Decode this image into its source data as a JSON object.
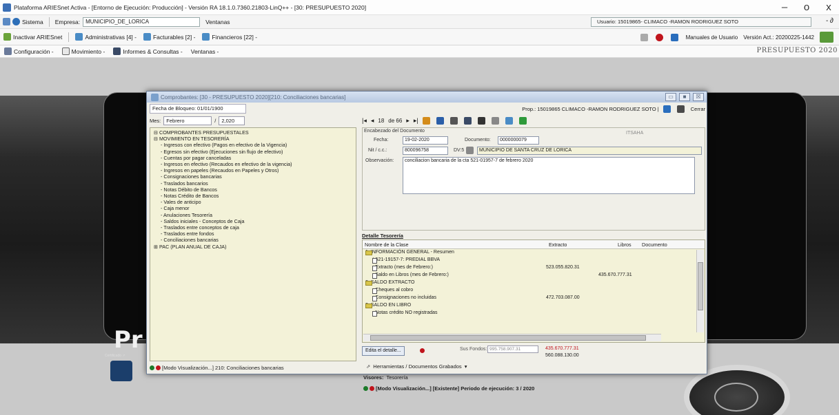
{
  "titlebar": {
    "title": "Plataforma ARIESnet Activa - [Entorno de Ejecución: Producción] - Versión RA 18.1.0.7360.21803-LinQ++ - [30: PRESUPUESTO 2020]",
    "minimize": "–",
    "maximize": "o",
    "close": "x"
  },
  "toolbar1": {
    "sistema": "Sistema",
    "empresa_label": "Empresa:",
    "empresa_value": "MUNICIPIO_DE_LORICA",
    "ventanas": "Ventanas",
    "usuario": "Usuario: 15019865- CLIMACO -RAMON RODRIGUEZ SOTO",
    "ctl": "- ∂"
  },
  "toolbar2": {
    "inactivar": "Inactivar ARIESnet",
    "administrativas": "Administrativas [4] -",
    "facturables": "Facturables [2] -",
    "financieros": "Financieros [22] -",
    "manuales": "Manuales de Usuario",
    "version": "Versión Act.: 20200225-1442"
  },
  "menubar": {
    "configuracion": "Configuración -",
    "movimiento": "Movimiento -",
    "informes": "Informes & Consultas -",
    "ventanas": "Ventanas -",
    "brand": "PRESUPUESTO 2020"
  },
  "desktop": {
    "big_text": "Pr",
    "tiny_text": "Certificado ↗"
  },
  "window": {
    "title": "Comprobantes: [30 - PRESUPUESTO 2020][210: Conciliaciones bancarias]",
    "btn_min": "▭",
    "btn_max": "■",
    "btn_close": "☒",
    "fecha_bloqueo": "Fecha de Bloqueo: 01/01/1900",
    "mes_label": "Mes:",
    "mes_value": "Febrero",
    "slash": "/",
    "anio_value": "2,020",
    "tree": [
      {
        "text": "⊟ COMPROBANTES PRESUPUESTALES",
        "level": 1
      },
      {
        "text": "⊟ MOVIMIENTO EN TESORERÍA",
        "level": 1
      },
      {
        "text": "Ingresos con efectivo (Pagos en efectivo de la Vigencia)",
        "level": 2
      },
      {
        "text": "Egresos sin efectivo (Ejecuciones sin flujo de efectivo)",
        "level": 2
      },
      {
        "text": "Cuentas por pagar canceladas",
        "level": 2
      },
      {
        "text": "Ingresos en efectivo (Recaudos en efectivo de la vigencia)",
        "level": 2
      },
      {
        "text": "Ingresos en papeles (Recaudos en Papeles y Otros)",
        "level": 2
      },
      {
        "text": "Consignaciones bancarias",
        "level": 2
      },
      {
        "text": "Traslados bancarios",
        "level": 2
      },
      {
        "text": "Notas Débito de Bancos",
        "level": 2
      },
      {
        "text": "Notas Crédito de Bancos",
        "level": 2
      },
      {
        "text": "Vales de anticipo",
        "level": 2
      },
      {
        "text": "Caja menor",
        "level": 2
      },
      {
        "text": "Anulaciones Tesorería",
        "level": 2
      },
      {
        "text": "Saldos iniciales - Conceptos de Caja",
        "level": 2
      },
      {
        "text": "Traslados entre conceptos de caja",
        "level": 2
      },
      {
        "text": "Traslados entre fondos",
        "level": 2
      },
      {
        "text": "Conciliaciones bancarias",
        "level": 2
      },
      {
        "text": "⊞ PAC (PLAN ANUAL DE CAJA)",
        "level": 1
      }
    ],
    "left_status": "[Modo Visualización...] 210: Conciliaciones bancarias",
    "prop": "Prop.: 15019865 CLIMACO -RAMON RODRIGUEZ SOTO |",
    "cerrar": "Cerrar",
    "nav": {
      "first": "|◂",
      "prev": "◂",
      "current": "18",
      "of": "de 66",
      "next": "▸",
      "last": "▸|"
    },
    "encab": {
      "title": "Encabezado del Documento",
      "status": "ITSAHA",
      "fecha_label": "Fecha:",
      "fecha_value": "19-02-2020",
      "documento_label": "Documento:",
      "documento_value": "0000000079",
      "nit_label": "Nit / c.c.:",
      "nit_value": "800096758",
      "dv_label": "DV:5",
      "tercero_value": "MUNICIPIO DE SANTA CRUZ DE LORICA",
      "obs_label": "Observación:",
      "obs_value": "conciliacion bancaria de la cta 521-01957-7 de febrero 2020"
    },
    "detalle_label": "Detalle Tesorería",
    "grid": {
      "col_nombre": "Nombre de la Clase",
      "col_extracto": "Extracto",
      "col_libros": "Libros",
      "col_documento": "Documento",
      "rows": [
        {
          "indent": 0,
          "icon": "folder",
          "name": "1. INFORMACIÓN GENERAL - Resumen",
          "extracto": "",
          "libros": ""
        },
        {
          "indent": 1,
          "icon": "doc",
          "name": "* 521-19157-7: PREDIAL BBVA",
          "extracto": "",
          "libros": ""
        },
        {
          "indent": 1,
          "icon": "doc",
          "name": "- Extracto (mes de Febrero:)",
          "extracto": "523.055.820.31",
          "libros": ""
        },
        {
          "indent": 1,
          "icon": "doc",
          "name": "- Saldo en Libros (mes de Febrero:)",
          "extracto": "",
          "libros": "435.670.777.31"
        },
        {
          "indent": 0,
          "icon": "folder",
          "name": "2. SALDO EXTRACTO",
          "extracto": "",
          "libros": ""
        },
        {
          "indent": 1,
          "icon": "doc",
          "name": "- Cheques al cobro",
          "extracto": "",
          "libros": ""
        },
        {
          "indent": 1,
          "icon": "doc",
          "name": "- Consignaciones no incluidas",
          "extracto": "472.703.087.00",
          "libros": ""
        },
        {
          "indent": 0,
          "icon": "folder",
          "name": "3. SALDO EN LIBRO",
          "extracto": "",
          "libros": ""
        },
        {
          "indent": 1,
          "icon": "doc",
          "name": "- Notas crédito NO registradas",
          "extracto": "",
          "libros": ""
        }
      ]
    },
    "edita": "Edita el detalle...",
    "sus_fondos_label": "Sus Fondos:",
    "sus_fondos_value": "995.758.907.31",
    "total_red": "435.670.777.31",
    "total_black": "560.088.130.00",
    "herramientas": "Herramientas / Documentos Grabados",
    "visores": "Visores:",
    "tesoreria": "Tesorería",
    "right_status": "[Modo Visualización...] [Existente] Periodo de ejecución: 3 / 2020"
  },
  "colors": {
    "tree_bg": "#f3f2d8",
    "folder": "#d8c54a",
    "red": "#c0141c",
    "window_title": "#c4d3ea"
  }
}
